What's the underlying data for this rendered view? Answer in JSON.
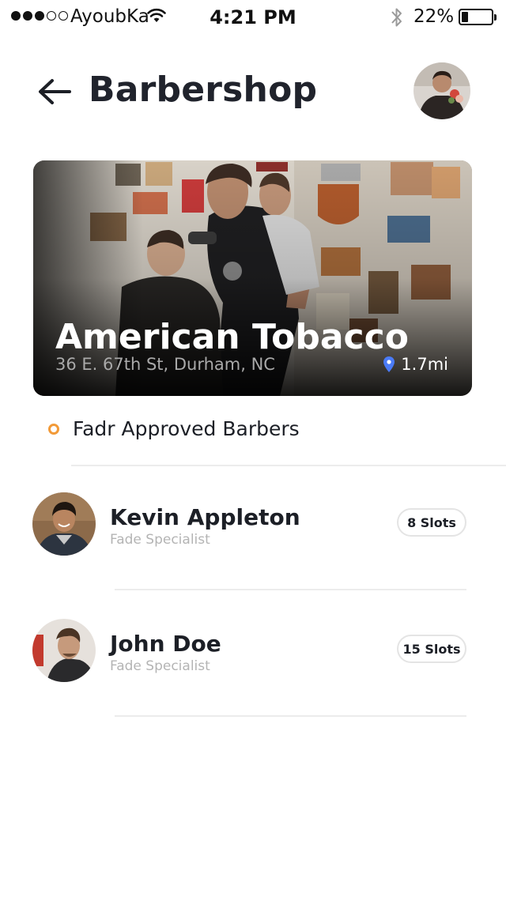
{
  "status_bar": {
    "carrier": "AyoubKa",
    "time": "4:21 PM",
    "battery": "22%",
    "battery_level": 0.22,
    "icons": [
      "signal-dots-icon",
      "wifi-icon",
      "bluetooth-icon",
      "battery-icon"
    ]
  },
  "header": {
    "title": "Barbershop",
    "back_icon": "arrow-left-icon"
  },
  "shop": {
    "name": "American Tobacco",
    "address": "36 E. 67th St, Durham, NC",
    "distance": "1.7mi",
    "distance_icon": "location-pin-icon"
  },
  "section": {
    "title": "Fadr Approved Barbers"
  },
  "barbers": [
    {
      "name": "Kevin Appleton",
      "role": "Fade Specialist",
      "slots": "8 Slots"
    },
    {
      "name": "John Doe",
      "role": "Fade Specialist",
      "slots": "15 Slots"
    }
  ],
  "colors": {
    "accent": "#f29a38",
    "pin": "#4a7bf7",
    "title": "#20232c",
    "muted": "#b4b4b4"
  }
}
